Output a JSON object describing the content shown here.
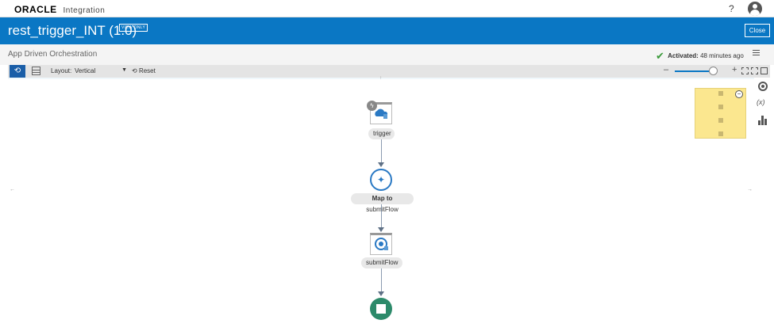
{
  "topbar": {
    "brand_name": "ORACLE",
    "brand_product": "Integration",
    "help_label": "?",
    "avatar_icon": "user-avatar-icon"
  },
  "titlebar": {
    "title": "rest_trigger_INT (1.0)",
    "badge": "VIEW ONLY",
    "close_label": "Close",
    "color": "#0a77c4"
  },
  "subheader": {
    "label": "App Driven Orchestration",
    "status_label": "Activated:",
    "status_value": "48 minutes ago",
    "status_color": "#3a9a3a"
  },
  "toolbar": {
    "layout_label": "Layout:",
    "layout_value": "Vertical",
    "reset_label": "Reset",
    "zoom_minus": "–",
    "zoom_plus": "+",
    "zoom_level": 0.9
  },
  "canvas": {
    "nodes": [
      {
        "label": "trigger",
        "icon": "cloud-rest-icon"
      },
      {
        "label_bold": "Map to",
        "label": "submitFlow",
        "icon": "mapper-icon"
      },
      {
        "label": "submitFlow",
        "icon": "invoke-icon"
      },
      {
        "icon": "stop-icon"
      }
    ]
  },
  "rightrail": {
    "var_label": "(x)"
  }
}
